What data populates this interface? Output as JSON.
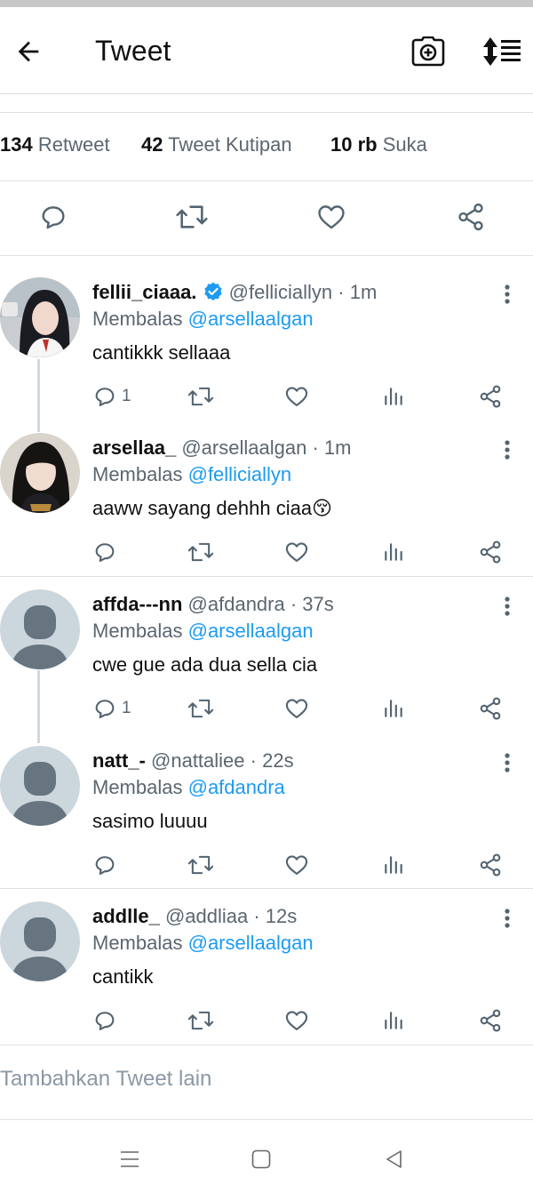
{
  "header": {
    "title": "Tweet",
    "back_icon": "arrow-left-icon",
    "camera_icon": "camera-plus-icon",
    "sort_icon": "sort-arrows-icon"
  },
  "stats": {
    "retweets": {
      "count": "134",
      "label": "Retweet"
    },
    "quotes": {
      "count": "42",
      "label": "Tweet Kutipan"
    },
    "likes": {
      "count": "10 rb",
      "label": "Suka"
    }
  },
  "colors": {
    "accent": "#1d9bf0",
    "muted": "#5b6670",
    "icon": "#536471",
    "verified": "#1d9bf0"
  },
  "replies": [
    {
      "name": "fellii_ciaaa.",
      "verified": true,
      "handle": "@felliciallyn",
      "time": "· 1m",
      "reply_prefix": "Membalas",
      "reply_to": "@arsellaalgan",
      "text": "cantikkk sellaaa",
      "reply_count": "1",
      "avatar": "photo"
    },
    {
      "name": "arsellaa_",
      "verified": false,
      "handle": "@arsellaalgan",
      "time": "· 1m",
      "reply_prefix": "Membalas",
      "reply_to": "@felliciallyn",
      "text": "aaww sayang dehhh ciaa😚",
      "reply_count": "",
      "avatar": "photo"
    },
    {
      "name": "affda---nn",
      "verified": false,
      "handle": "@afdandra",
      "time": "· 37s",
      "reply_prefix": "Membalas",
      "reply_to": "@arsellaalgan",
      "text": "cwe gue ada dua sella cia",
      "reply_count": "1",
      "avatar": "default"
    },
    {
      "name": "natt_-",
      "verified": false,
      "handle": "@nattaliee",
      "time": "· 22s",
      "reply_prefix": "Membalas",
      "reply_to": "@afdandra",
      "text": "sasimo luuuu",
      "reply_count": "",
      "avatar": "default"
    },
    {
      "name": "addlle_",
      "verified": false,
      "handle": "@addliaa",
      "time": "· 12s",
      "reply_prefix": "Membalas",
      "reply_to": "@arsellaalgan",
      "text": "cantikk",
      "reply_count": "",
      "avatar": "default"
    }
  ],
  "compose": {
    "placeholder": "Tambahkan Tweet lain"
  },
  "navbar": {
    "menu_icon": "menu-icon",
    "home_icon": "home-square-icon",
    "back_icon": "back-triangle-icon"
  }
}
